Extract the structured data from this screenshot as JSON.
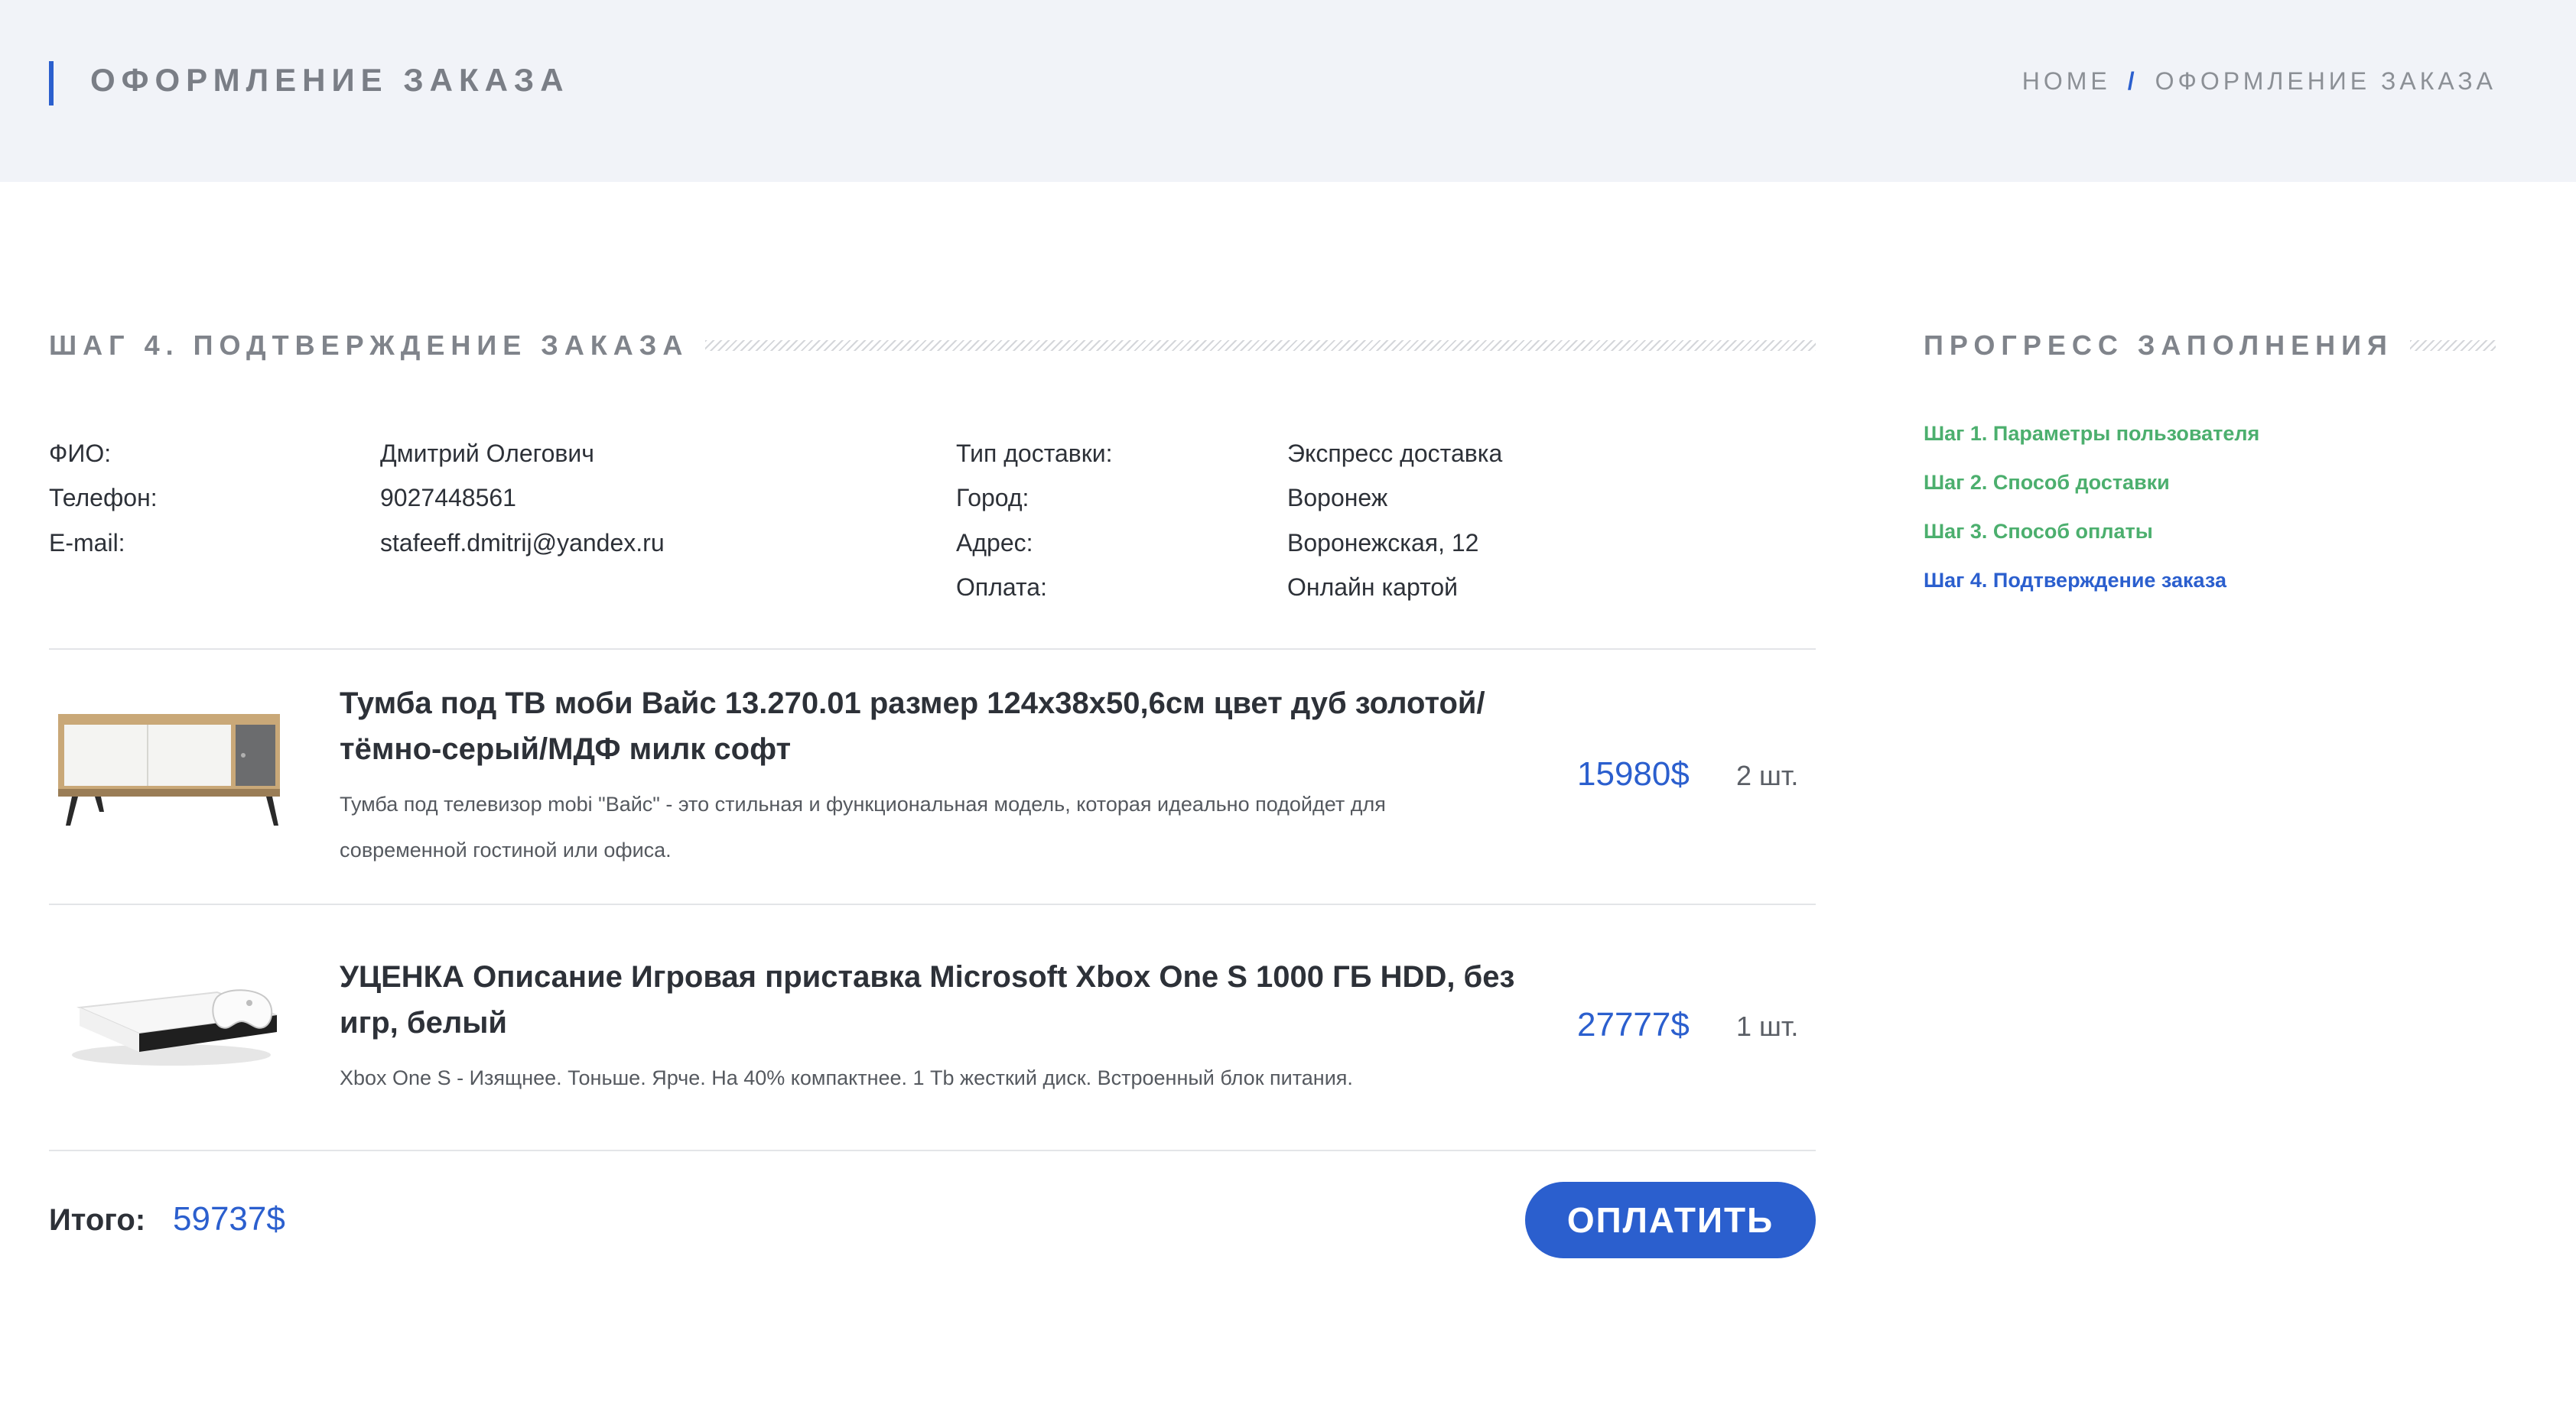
{
  "header": {
    "title": "ОФОРМЛЕНИЕ ЗАКАЗА",
    "breadcrumb": {
      "home": "HOME",
      "separator": "/",
      "current": "ОФОРМЛЕНИЕ ЗАКАЗА"
    }
  },
  "main": {
    "section_title": "ШАГ 4. ПОДТВЕРЖДЕНИЕ ЗАКАЗА",
    "customer": {
      "name_label": "ФИО:",
      "name": "Дмитрий Олегович",
      "phone_label": "Телефон:",
      "phone": "9027448561",
      "email_label": "E-mail:",
      "email": "stafeeff.dmitrij@yandex.ru"
    },
    "delivery": {
      "type_label": "Тип доставки:",
      "type": "Экспресс доставка",
      "city_label": "Город:",
      "city": "Воронеж",
      "address_label": "Адрес:",
      "address": "Воронежская, 12",
      "payment_label": "Оплата:",
      "payment": "Онлайн картой"
    },
    "products": [
      {
        "title_line1": "Тумба под ТВ моби Вайс 13.270.01 размер 124х38х50,6см цвет дуб золотой/",
        "title_line2": "тёмно-серый/МДФ милк софт",
        "desc_line1": "Тумба под телевизор mobi \"Вайс\" - это стильная и функциональная модель, которая идеально подойдет для",
        "desc_line2": "современной гостиной или офиса.",
        "price": "15980$",
        "qty": "2 шт.",
        "image": "tv-stand-image"
      },
      {
        "title_line1": "УЦЕНКА Описание Игровая приставка Microsoft Xbox One S 1000 ГБ HDD, без",
        "title_line2": "игр, белый",
        "desc_line1": "Xbox One S - Изящнее. Тоньше. Ярче. На 40% компактнее. 1 Tb жесткий диск. Встроенный блок питания.",
        "price": "27777$",
        "qty": "1 шт.",
        "image": "xbox-console-image"
      }
    ],
    "total_label": "Итого:",
    "total_value": "59737$",
    "pay_button": "ОПЛАТИТЬ"
  },
  "sidebar": {
    "title": "ПРОГРЕСС ЗАПОЛНЕНИЯ",
    "steps": [
      {
        "label": "Шаг 1. Параметры пользователя",
        "state": "done"
      },
      {
        "label": "Шаг 2. Способ доставки",
        "state": "done"
      },
      {
        "label": "Шаг 3. Способ оплаты",
        "state": "done"
      },
      {
        "label": "Шаг 4. Подтверждение заказа",
        "state": "active"
      }
    ]
  },
  "colors": {
    "accent": "#2b5fce",
    "done": "#4caf6e",
    "header_bg": "#f1f3f8"
  }
}
